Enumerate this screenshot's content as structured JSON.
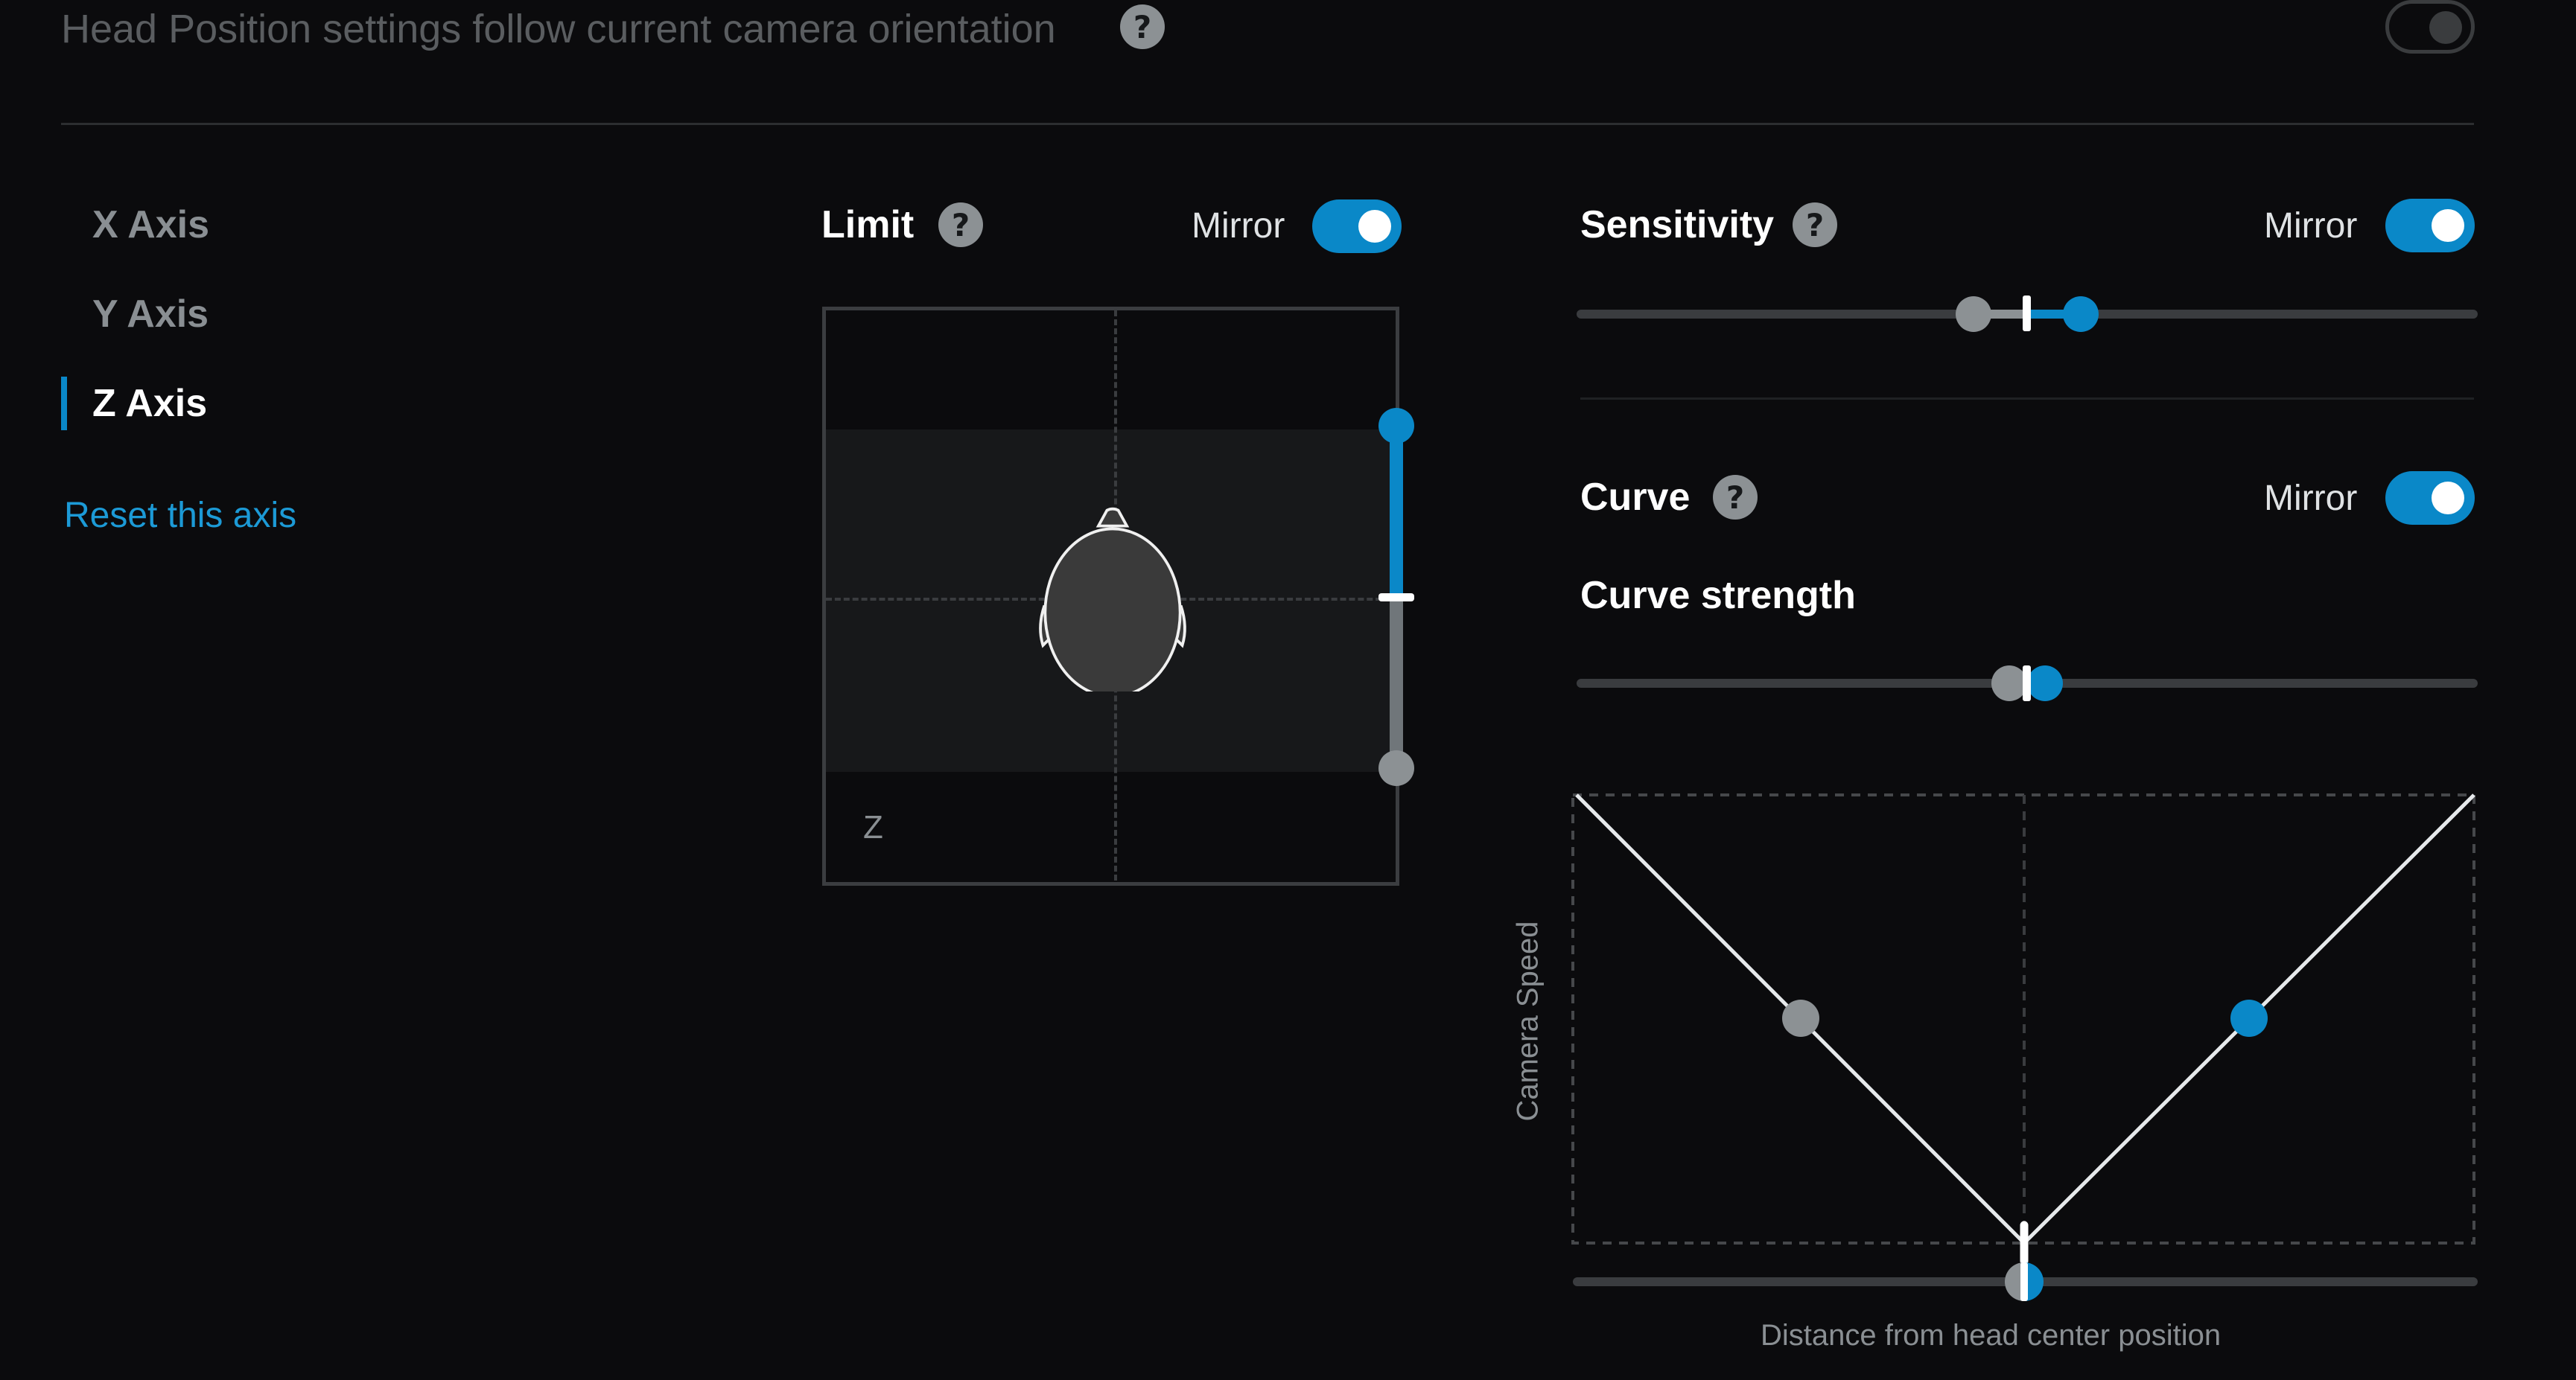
{
  "header": {
    "follow_label": "Head Position settings follow current camera orientation",
    "follow_enabled": false
  },
  "axes": {
    "items": [
      {
        "label": "X Axis",
        "active": false
      },
      {
        "label": "Y Axis",
        "active": false
      },
      {
        "label": "Z Axis",
        "active": true
      }
    ],
    "reset_label": "Reset this axis"
  },
  "limit": {
    "title": "Limit",
    "mirror_label": "Mirror",
    "mirror_enabled": true,
    "axis_letter": "Z"
  },
  "sensitivity": {
    "title": "Sensitivity",
    "mirror_label": "Mirror",
    "mirror_enabled": true
  },
  "curve": {
    "title": "Curve",
    "mirror_label": "Mirror",
    "mirror_enabled": true,
    "strength_label": "Curve strength",
    "y_axis_label": "Camera Speed",
    "x_axis_label": "Distance from head center position"
  },
  "colors": {
    "accent": "#0a88c8",
    "background": "#0b0b0d",
    "inactive_handle": "#8c9194"
  },
  "icons": {
    "help": "question-circle-icon",
    "head": "head-top-view-icon"
  }
}
